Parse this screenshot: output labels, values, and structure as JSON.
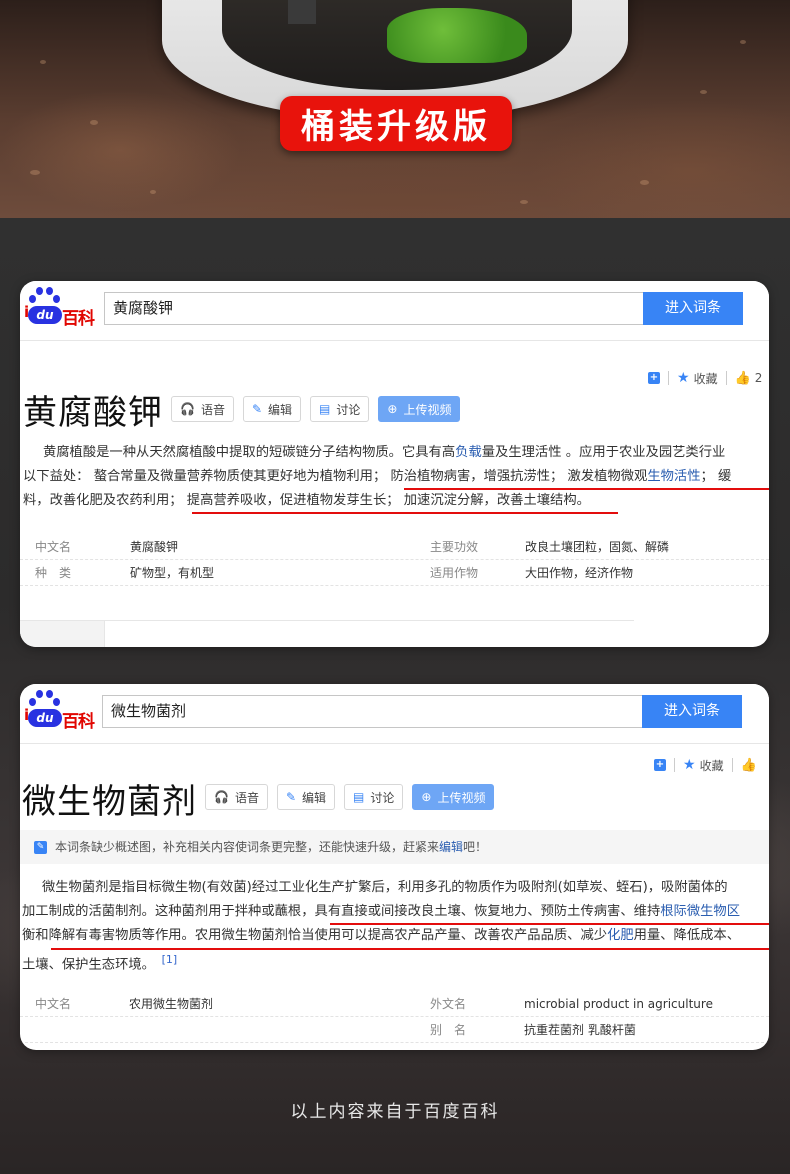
{
  "hero": {
    "banner": "桶装升级版"
  },
  "card1": {
    "search_value": "黄腐酸钾",
    "search_button": "进入词条",
    "tools": {
      "collect": "收藏",
      "like_count": "2"
    },
    "title": "黄腐酸钾",
    "buttons": {
      "voice": "语音",
      "edit": "编辑",
      "discuss": "讨论",
      "upload": "上传视频"
    },
    "para": {
      "l1a": "黄腐植酸是一种从天然腐植酸中提取的短碳链分子结构物质。它具有高",
      "l1_link": "负载",
      "l1b": "量及生理活性 。应用于农业及园艺类行业",
      "l2a": "以下益处： 螯合常量及微量营养物质使其更好地为植物利用； 防治植物病害，增强抗涝性； 激发植物微观",
      "l2_link": "生物活性",
      "l2b": "； 缓",
      "l3": "料，改善化肥及农药利用； 提高营养吸收，促进植物发芽生长； 加速沉淀分解，改善土壤结构。"
    },
    "info": [
      {
        "k1": "中文名",
        "v1": "黄腐酸钾",
        "k2": "主要功效",
        "v2": "改良土壤团粒，固氮、解磷"
      },
      {
        "k1": "种　类",
        "v1": "矿物型，有机型",
        "k2": "适用作物",
        "v2": "大田作物，经济作物"
      }
    ]
  },
  "card2": {
    "search_value": "微生物菌剂",
    "search_button": "进入词条",
    "tools": {
      "collect": "收藏"
    },
    "title": "微生物菌剂",
    "buttons": {
      "voice": "语音",
      "edit": "编辑",
      "discuss": "讨论",
      "upload": "上传视频"
    },
    "notice": {
      "text": "本词条缺少概述图，补充相关内容使词条更完整，还能快速升级，赶紧来",
      "link": "编辑",
      "tail": "吧！"
    },
    "para": {
      "l1": "微生物菌剂是指目标微生物(有效菌)经过工业化生产扩繁后，利用多孔的物质作为吸附剂(如草炭、蛭石)，吸附菌体的",
      "l2a": "加工制成的活菌制剂。这种菌剂用于拌种或蘸根，具有直接或间接改良土壤、恢复地力、预防土传病害、维持",
      "l2_link": "根际微生物区",
      "l3a": "衡和降解有毒害物质等作用。农用微生物菌剂恰当使用可以提高农产品产量、改善农产品品质、减少",
      "l3_link": "化肥",
      "l3b": "用量、降低成本、",
      "l4": "土壤、保护生态环境。",
      "ref": "[1]"
    },
    "info": [
      {
        "k1": "中文名",
        "v1": "农用微生物菌剂",
        "k2": "外文名",
        "v2": "microbial product in agriculture"
      },
      {
        "k1": "",
        "v1": "",
        "k2": "别　名",
        "v2": "抗重茬菌剂 乳酸杆菌"
      }
    ]
  },
  "footer": "以上内容来自于百度百科",
  "colors": {
    "accent": "#3884f5",
    "underline": "#e30d0d",
    "banner": "#e8130c"
  }
}
